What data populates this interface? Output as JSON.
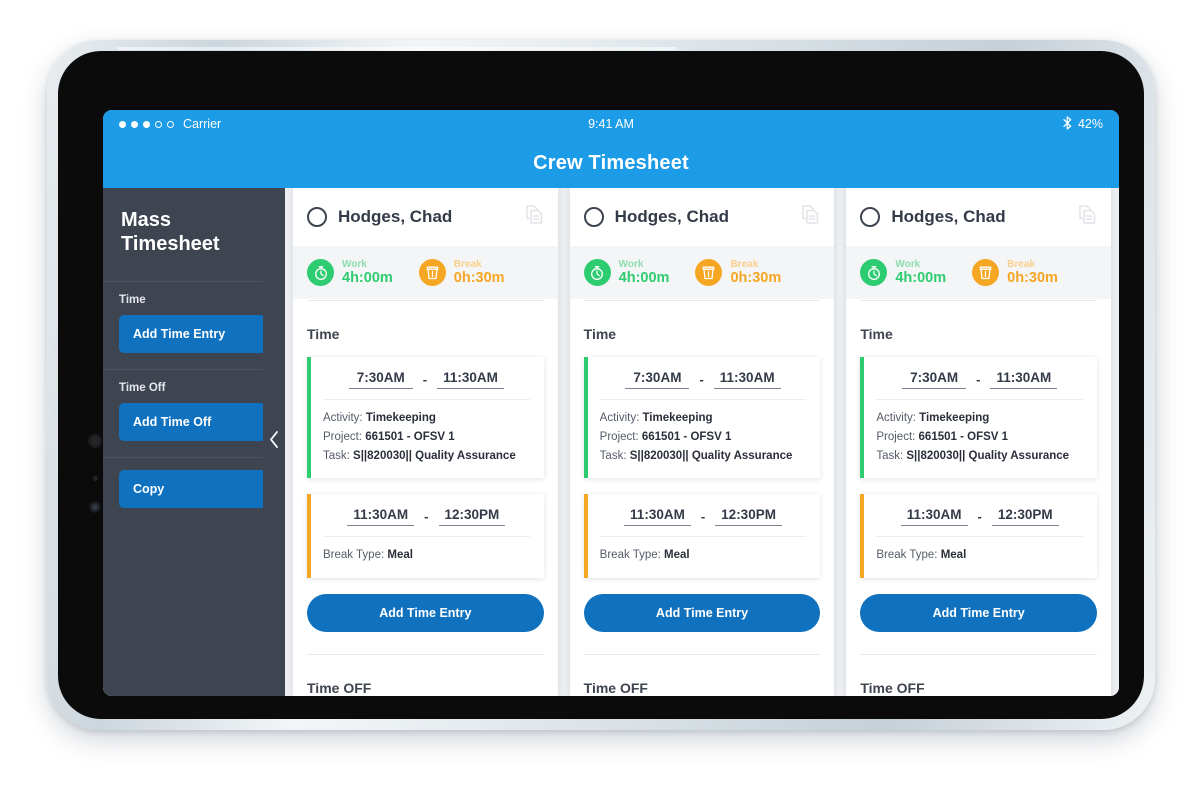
{
  "status_bar": {
    "carrier": "Carrier",
    "signal_dots_filled": 3,
    "signal_dots_empty": 2,
    "time": "9:41 AM",
    "bluetooth_icon": "bluetooth-icon",
    "battery": "42%"
  },
  "app_bar": {
    "title": "Crew Timesheet",
    "accent_color": "#1c9be6"
  },
  "sidebar": {
    "title": "Mass Timesheet",
    "collapse_icon": "chevron-left-icon",
    "sections": [
      {
        "label": "Time",
        "button": "Add Time Entry"
      },
      {
        "label": "Time Off",
        "button": "Add Time Off"
      }
    ],
    "copy_button": "Copy",
    "button_color": "#1072bf",
    "background_color": "#3e4450"
  },
  "cards": [
    {
      "employee": "Hodges, Chad",
      "select_icon": "radio-circle-icon",
      "copy_icon": "copy-document-icon",
      "summary": {
        "work": {
          "icon": "stopwatch-icon",
          "label": "Work",
          "value": "4h:00m",
          "color": "#2ecc71"
        },
        "break": {
          "icon": "cup-icon",
          "label": "Break",
          "value": "0h:30m",
          "color": "#f5a623"
        }
      },
      "time_section_title": "Time",
      "entries": [
        {
          "type": "work",
          "accent": "#2ecc71",
          "start": "7:30AM",
          "end": "11:30AM",
          "separator": "-",
          "meta": [
            {
              "key": "Activity:",
              "value": "Timekeeping"
            },
            {
              "key": "Project:",
              "value": "661501 - OFSV 1"
            },
            {
              "key": "Task:",
              "value": "S||820030|| Quality Assurance"
            }
          ]
        },
        {
          "type": "break",
          "accent": "#f5a623",
          "start": "11:30AM",
          "end": "12:30PM",
          "separator": "-",
          "meta": [
            {
              "key": "Break Type:",
              "value": "Meal"
            }
          ]
        }
      ],
      "add_entry_button": "Add Time Entry",
      "timeoff_section_title": "Time OFF"
    },
    {
      "employee": "Hodges, Chad",
      "select_icon": "radio-circle-icon",
      "copy_icon": "copy-document-icon",
      "summary": {
        "work": {
          "icon": "stopwatch-icon",
          "label": "Work",
          "value": "4h:00m",
          "color": "#2ecc71"
        },
        "break": {
          "icon": "cup-icon",
          "label": "Break",
          "value": "0h:30m",
          "color": "#f5a623"
        }
      },
      "time_section_title": "Time",
      "entries": [
        {
          "type": "work",
          "accent": "#2ecc71",
          "start": "7:30AM",
          "end": "11:30AM",
          "separator": "-",
          "meta": [
            {
              "key": "Activity:",
              "value": "Timekeeping"
            },
            {
              "key": "Project:",
              "value": "661501 - OFSV 1"
            },
            {
              "key": "Task:",
              "value": "S||820030|| Quality Assurance"
            }
          ]
        },
        {
          "type": "break",
          "accent": "#f5a623",
          "start": "11:30AM",
          "end": "12:30PM",
          "separator": "-",
          "meta": [
            {
              "key": "Break Type:",
              "value": "Meal"
            }
          ]
        }
      ],
      "add_entry_button": "Add Time Entry",
      "timeoff_section_title": "Time OFF"
    },
    {
      "employee": "Hodges, Chad",
      "select_icon": "radio-circle-icon",
      "copy_icon": "copy-document-icon",
      "summary": {
        "work": {
          "icon": "stopwatch-icon",
          "label": "Work",
          "value": "4h:00m",
          "color": "#2ecc71"
        },
        "break": {
          "icon": "cup-icon",
          "label": "Break",
          "value": "0h:30m",
          "color": "#f5a623"
        }
      },
      "time_section_title": "Time",
      "entries": [
        {
          "type": "work",
          "accent": "#2ecc71",
          "start": "7:30AM",
          "end": "11:30AM",
          "separator": "-",
          "meta": [
            {
              "key": "Activity:",
              "value": "Timekeeping"
            },
            {
              "key": "Project:",
              "value": "661501 - OFSV 1"
            },
            {
              "key": "Task:",
              "value": "S||820030|| Quality Assurance"
            }
          ]
        },
        {
          "type": "break",
          "accent": "#f5a623",
          "start": "11:30AM",
          "end": "12:30PM",
          "separator": "-",
          "meta": [
            {
              "key": "Break Type:",
              "value": "Meal"
            }
          ]
        }
      ],
      "add_entry_button": "Add Time Entry",
      "timeoff_section_title": "Time OFF"
    }
  ]
}
